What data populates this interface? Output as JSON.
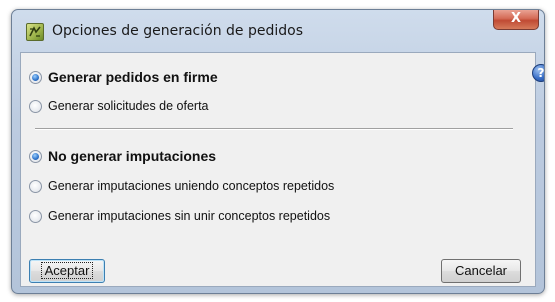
{
  "window": {
    "title": "Opciones de generación de pedidos",
    "close_label": "X",
    "icon": "app-document-icon"
  },
  "help": {
    "icon": "help-question-icon",
    "label": "?"
  },
  "group1": {
    "options": [
      {
        "label": "Generar pedidos en firme",
        "checked": true
      },
      {
        "label": "Generar solicitudes de oferta",
        "checked": false
      }
    ]
  },
  "group2": {
    "options": [
      {
        "label": "No generar imputaciones",
        "checked": true
      },
      {
        "label": "Generar imputaciones uniendo conceptos repetidos",
        "checked": false
      },
      {
        "label": "Generar imputaciones sin unir conceptos repetidos",
        "checked": false
      }
    ]
  },
  "buttons": {
    "accept_label": "Aceptar",
    "cancel_label": "Cancelar"
  }
}
